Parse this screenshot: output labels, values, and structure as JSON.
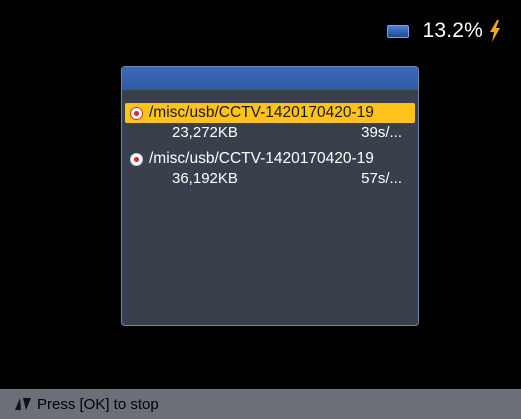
{
  "status": {
    "battery_percent": "13.2%",
    "battery_icon": "battery-icon",
    "charging_icon": "lightning-bolt-icon"
  },
  "recordings": [
    {
      "path": "/misc/usb/CCTV-1420170420-19",
      "size": "23,272KB",
      "duration": "39s/...",
      "selected": true
    },
    {
      "path": "/misc/usb/CCTV-1420170420-19",
      "size": "36,192KB",
      "duration": "57s/...",
      "selected": false
    }
  ],
  "hint": {
    "icon": "up-down-arrows-icon",
    "text": "Press [OK] to stop"
  },
  "colors": {
    "highlight": "#ffc31b",
    "panel_header": "#3563b0",
    "panel_bg": "#38414b",
    "bottom_bar": "#6b6f78",
    "radio_dot": "#d6252b"
  }
}
